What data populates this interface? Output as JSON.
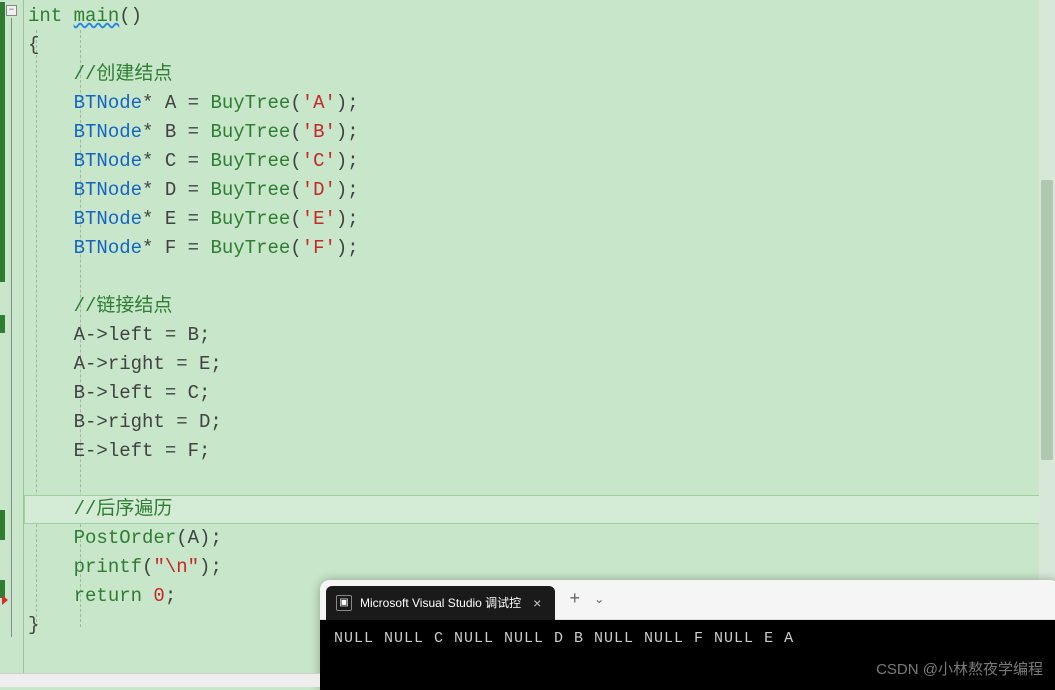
{
  "code": {
    "l1_kw_int": "int",
    "l1_main": "main",
    "l1_parens": "()",
    "l2_brace": "{",
    "l3_comment": "//创建结点",
    "l4_type": "BTNode",
    "l4_star": "*",
    "l4_var": " A ",
    "l4_eq": "=",
    "l4_func": " BuyTree",
    "l4_open": "(",
    "l4_char": "'A'",
    "l4_close": ");",
    "l5_var": " B ",
    "l5_char": "'B'",
    "l6_var": " C ",
    "l6_char": "'C'",
    "l7_var": " D ",
    "l7_char": "'D'",
    "l8_var": " E ",
    "l8_char": "'E'",
    "l9_var": " F ",
    "l9_char": "'F'",
    "l11_comment": "//链接结点",
    "l12": "A->left = B;",
    "l13": "A->right = E;",
    "l14": "B->left = C;",
    "l15": "B->right = D;",
    "l16": "E->left = F;",
    "l18_comment": "//后序遍历",
    "l19_func": "PostOrder",
    "l19_open": "(",
    "l19_arg": "A",
    "l19_close": ");",
    "l20_func": "printf",
    "l20_open": "(",
    "l20_str": "\"\\n\"",
    "l20_close": ");",
    "l21_ret": "return",
    "l21_val": " 0",
    "l21_semi": ";",
    "l22_brace": "}"
  },
  "terminal": {
    "tab_title": "Microsoft Visual Studio 调试控",
    "output": "NULL NULL C NULL NULL D B NULL NULL F NULL E A"
  },
  "watermark": "CSDN @小林熬夜学编程",
  "icons": {
    "fold": "−",
    "close": "×",
    "plus": "+",
    "dropdown": "⌄"
  }
}
